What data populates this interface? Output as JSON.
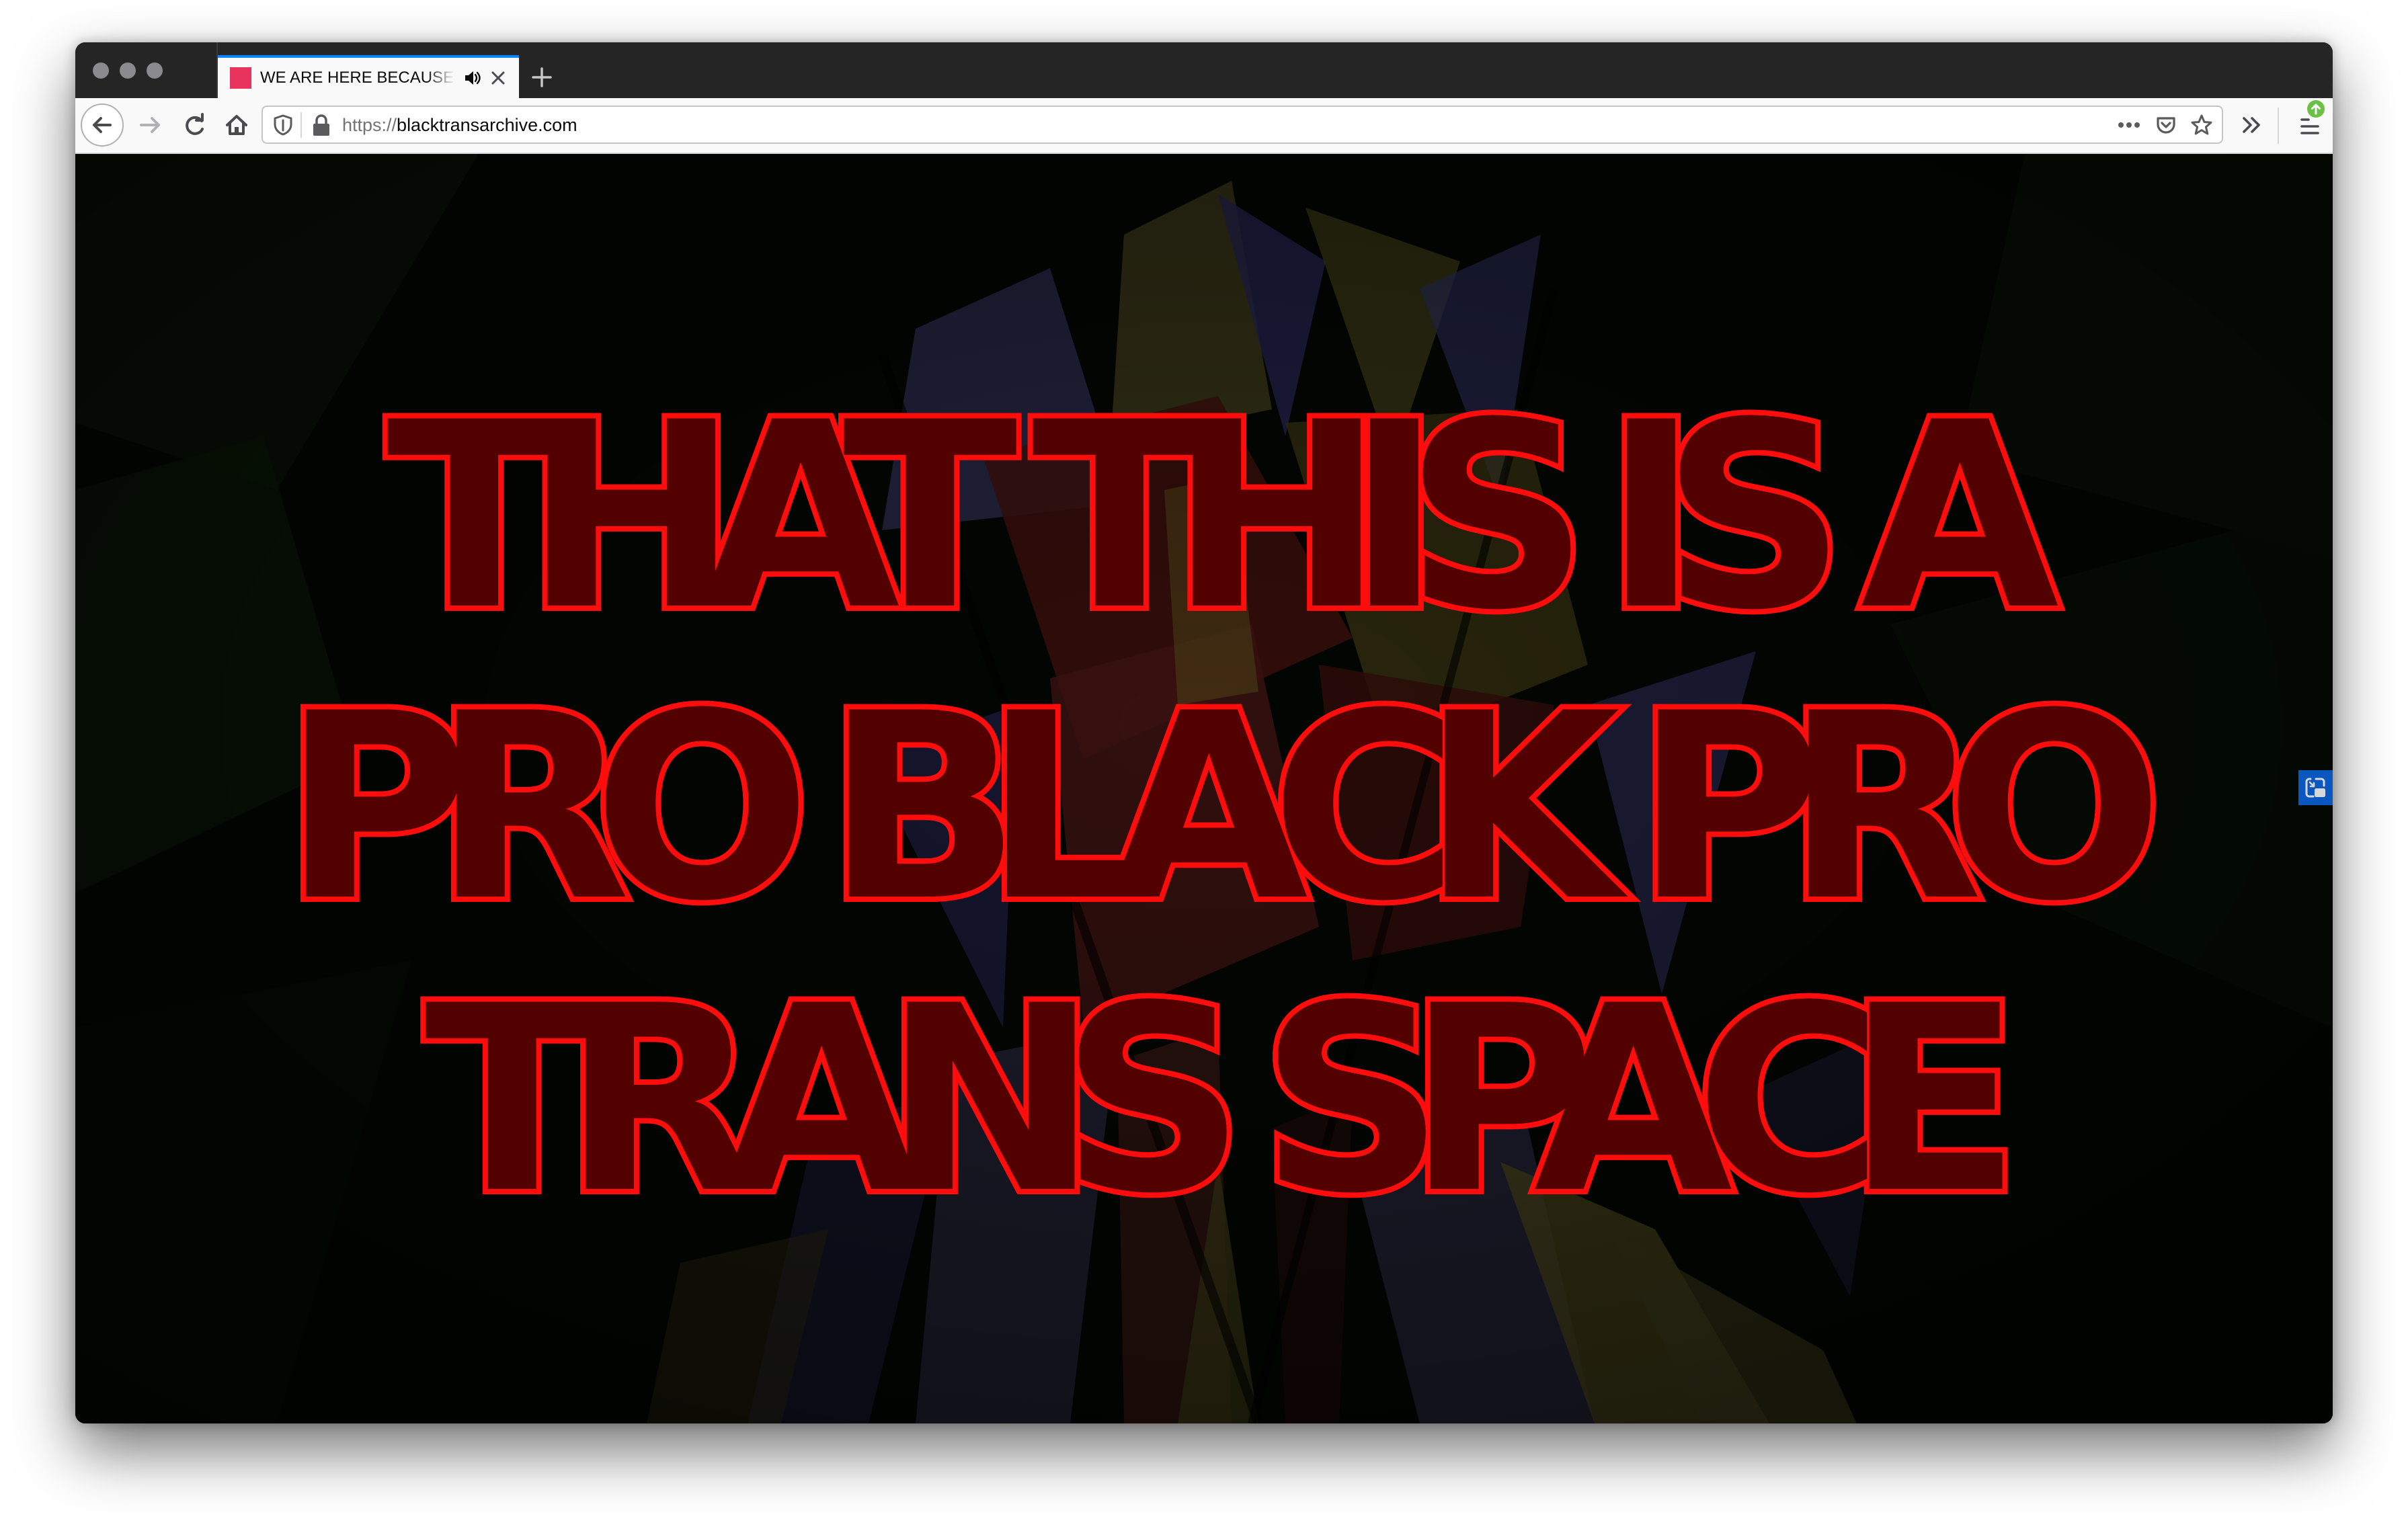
{
  "browser": {
    "tab": {
      "title": "WE ARE HERE BECAUSE OF",
      "favicon_color": "#e8335e",
      "audio_icon": "speaker-playing-icon",
      "close_icon": "close-icon"
    },
    "new_tab_icon": "plus-icon",
    "toolbar": {
      "back_icon": "arrow-left-icon",
      "forward_icon": "arrow-right-icon",
      "reload_icon": "reload-icon",
      "home_icon": "home-icon",
      "overflow_icon": "double-chevron-right-icon",
      "menu_icon": "hamburger-menu-icon",
      "update_badge_icon": "arrow-up-icon"
    },
    "urlbar": {
      "scheme": "https://",
      "host": "blacktransarchive.com",
      "tracking_icon": "shield-icon",
      "security_icon": "lock-icon",
      "page_actions_icon": "more-dots-icon",
      "pocket_icon": "pocket-icon",
      "bookmark_icon": "star-icon"
    },
    "accent_color": "#0a84ff",
    "update_badge_color": "#6bc046"
  },
  "page": {
    "headline_lines": [
      "THAT THIS IS A",
      "PRO BLACK PRO",
      "TRANS SPACE"
    ],
    "headline_fill_color": "#530000",
    "headline_stroke_color": "#ff0d0d",
    "pip_toggle_icon": "picture-in-picture-icon",
    "pip_toggle_color": "#0b57c0"
  }
}
